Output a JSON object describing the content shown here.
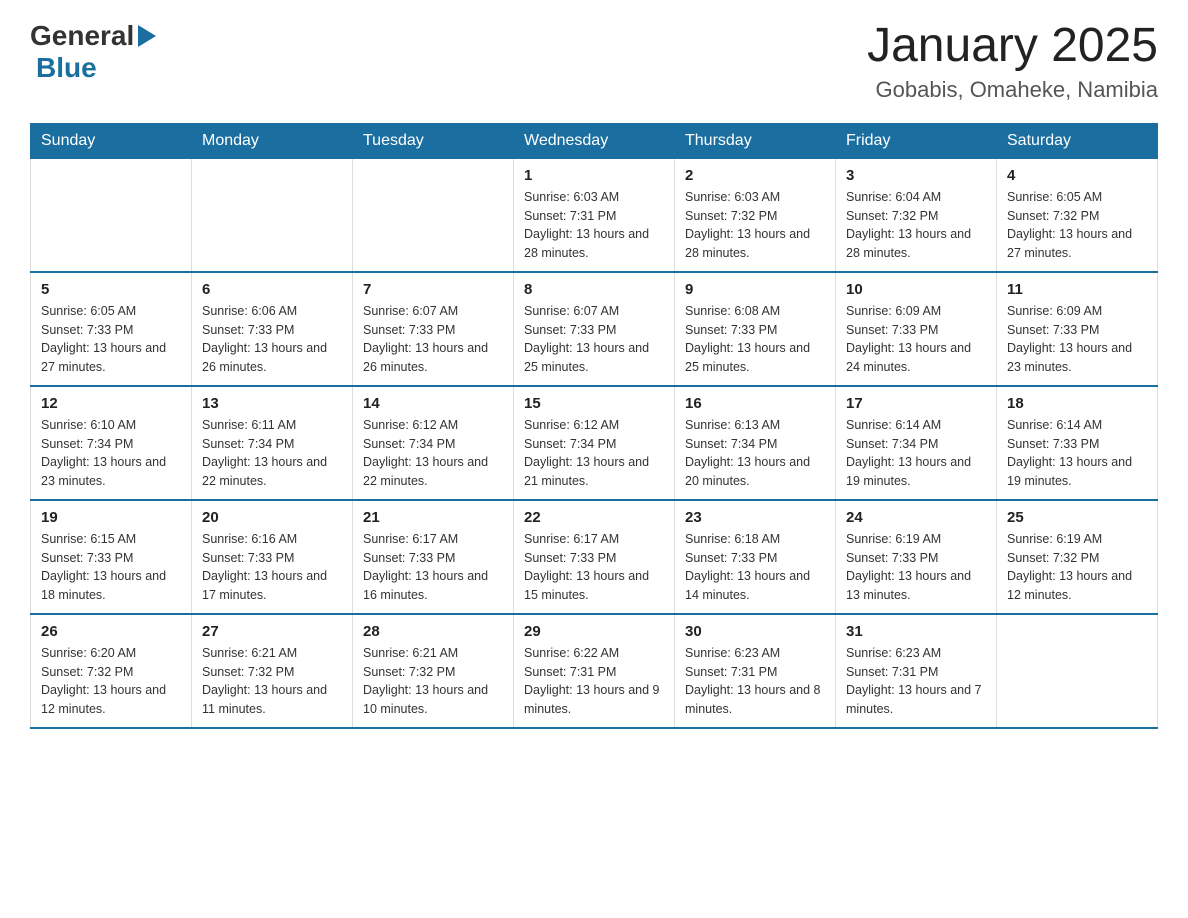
{
  "logo": {
    "general": "General",
    "blue": "Blue"
  },
  "title": "January 2025",
  "subtitle": "Gobabis, Omaheke, Namibia",
  "days_header": [
    "Sunday",
    "Monday",
    "Tuesday",
    "Wednesday",
    "Thursday",
    "Friday",
    "Saturday"
  ],
  "weeks": [
    [
      {
        "day": "",
        "info": ""
      },
      {
        "day": "",
        "info": ""
      },
      {
        "day": "",
        "info": ""
      },
      {
        "day": "1",
        "info": "Sunrise: 6:03 AM\nSunset: 7:31 PM\nDaylight: 13 hours and 28 minutes."
      },
      {
        "day": "2",
        "info": "Sunrise: 6:03 AM\nSunset: 7:32 PM\nDaylight: 13 hours and 28 minutes."
      },
      {
        "day": "3",
        "info": "Sunrise: 6:04 AM\nSunset: 7:32 PM\nDaylight: 13 hours and 28 minutes."
      },
      {
        "day": "4",
        "info": "Sunrise: 6:05 AM\nSunset: 7:32 PM\nDaylight: 13 hours and 27 minutes."
      }
    ],
    [
      {
        "day": "5",
        "info": "Sunrise: 6:05 AM\nSunset: 7:33 PM\nDaylight: 13 hours and 27 minutes."
      },
      {
        "day": "6",
        "info": "Sunrise: 6:06 AM\nSunset: 7:33 PM\nDaylight: 13 hours and 26 minutes."
      },
      {
        "day": "7",
        "info": "Sunrise: 6:07 AM\nSunset: 7:33 PM\nDaylight: 13 hours and 26 minutes."
      },
      {
        "day": "8",
        "info": "Sunrise: 6:07 AM\nSunset: 7:33 PM\nDaylight: 13 hours and 25 minutes."
      },
      {
        "day": "9",
        "info": "Sunrise: 6:08 AM\nSunset: 7:33 PM\nDaylight: 13 hours and 25 minutes."
      },
      {
        "day": "10",
        "info": "Sunrise: 6:09 AM\nSunset: 7:33 PM\nDaylight: 13 hours and 24 minutes."
      },
      {
        "day": "11",
        "info": "Sunrise: 6:09 AM\nSunset: 7:33 PM\nDaylight: 13 hours and 23 minutes."
      }
    ],
    [
      {
        "day": "12",
        "info": "Sunrise: 6:10 AM\nSunset: 7:34 PM\nDaylight: 13 hours and 23 minutes."
      },
      {
        "day": "13",
        "info": "Sunrise: 6:11 AM\nSunset: 7:34 PM\nDaylight: 13 hours and 22 minutes."
      },
      {
        "day": "14",
        "info": "Sunrise: 6:12 AM\nSunset: 7:34 PM\nDaylight: 13 hours and 22 minutes."
      },
      {
        "day": "15",
        "info": "Sunrise: 6:12 AM\nSunset: 7:34 PM\nDaylight: 13 hours and 21 minutes."
      },
      {
        "day": "16",
        "info": "Sunrise: 6:13 AM\nSunset: 7:34 PM\nDaylight: 13 hours and 20 minutes."
      },
      {
        "day": "17",
        "info": "Sunrise: 6:14 AM\nSunset: 7:34 PM\nDaylight: 13 hours and 19 minutes."
      },
      {
        "day": "18",
        "info": "Sunrise: 6:14 AM\nSunset: 7:33 PM\nDaylight: 13 hours and 19 minutes."
      }
    ],
    [
      {
        "day": "19",
        "info": "Sunrise: 6:15 AM\nSunset: 7:33 PM\nDaylight: 13 hours and 18 minutes."
      },
      {
        "day": "20",
        "info": "Sunrise: 6:16 AM\nSunset: 7:33 PM\nDaylight: 13 hours and 17 minutes."
      },
      {
        "day": "21",
        "info": "Sunrise: 6:17 AM\nSunset: 7:33 PM\nDaylight: 13 hours and 16 minutes."
      },
      {
        "day": "22",
        "info": "Sunrise: 6:17 AM\nSunset: 7:33 PM\nDaylight: 13 hours and 15 minutes."
      },
      {
        "day": "23",
        "info": "Sunrise: 6:18 AM\nSunset: 7:33 PM\nDaylight: 13 hours and 14 minutes."
      },
      {
        "day": "24",
        "info": "Sunrise: 6:19 AM\nSunset: 7:33 PM\nDaylight: 13 hours and 13 minutes."
      },
      {
        "day": "25",
        "info": "Sunrise: 6:19 AM\nSunset: 7:32 PM\nDaylight: 13 hours and 12 minutes."
      }
    ],
    [
      {
        "day": "26",
        "info": "Sunrise: 6:20 AM\nSunset: 7:32 PM\nDaylight: 13 hours and 12 minutes."
      },
      {
        "day": "27",
        "info": "Sunrise: 6:21 AM\nSunset: 7:32 PM\nDaylight: 13 hours and 11 minutes."
      },
      {
        "day": "28",
        "info": "Sunrise: 6:21 AM\nSunset: 7:32 PM\nDaylight: 13 hours and 10 minutes."
      },
      {
        "day": "29",
        "info": "Sunrise: 6:22 AM\nSunset: 7:31 PM\nDaylight: 13 hours and 9 minutes."
      },
      {
        "day": "30",
        "info": "Sunrise: 6:23 AM\nSunset: 7:31 PM\nDaylight: 13 hours and 8 minutes."
      },
      {
        "day": "31",
        "info": "Sunrise: 6:23 AM\nSunset: 7:31 PM\nDaylight: 13 hours and 7 minutes."
      },
      {
        "day": "",
        "info": ""
      }
    ]
  ]
}
